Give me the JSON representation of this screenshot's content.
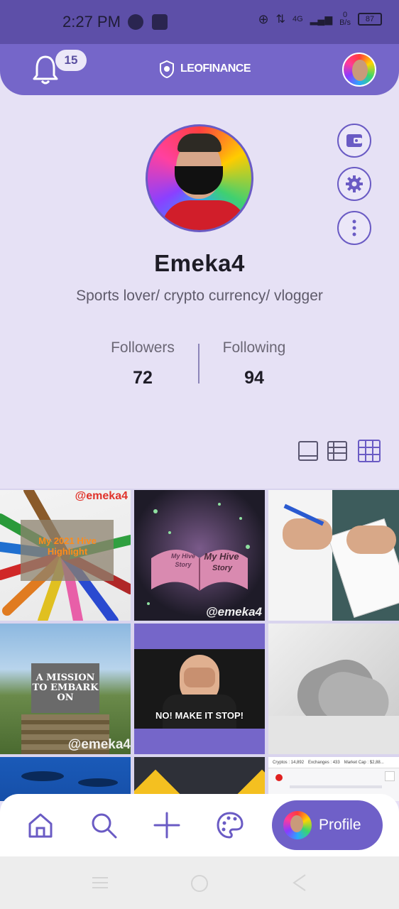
{
  "status_bar": {
    "time": "2:27 PM",
    "network": "4G",
    "data_rate_value": "0",
    "data_rate_unit": "B/s",
    "battery": "87"
  },
  "header": {
    "notification_count": "15",
    "brand": "LEOFINANCE",
    "icons": [
      "bell-icon",
      "leo-logo-icon",
      "avatar"
    ]
  },
  "profile": {
    "username": "Emeka4",
    "bio": "Sports lover/ crypto currency/ vlogger",
    "followers_label": "Followers",
    "followers_count": "72",
    "following_label": "Following",
    "following_count": "94"
  },
  "side_actions": [
    "wallet-icon",
    "settings-icon",
    "more-options-icon"
  ],
  "view_modes": [
    "single-view-icon",
    "list-view-icon",
    "grid-view-icon"
  ],
  "grid_posts": [
    {
      "watermark": "@emeka4",
      "title": "My 2021 Hive Highlight"
    },
    {
      "title_line1": "My Hive",
      "title_line2": "Story",
      "book_text_1": "My Hive",
      "book_text_2": "Story",
      "watermark": "@emeka4"
    },
    {
      "title": ""
    },
    {
      "title": "A MISSION TO EMBARK ON",
      "watermark": "@emeka4"
    },
    {
      "caption": "NO! MAKE IT STOP!"
    },
    {
      "title": ""
    },
    {
      "title": ""
    },
    {
      "title": ""
    },
    {
      "strip_1": "Cryptos : 14,892",
      "strip_2": "Exchanges : 433",
      "strip_3": "Market Cap : $2,88..."
    }
  ],
  "bottom_nav": {
    "items": [
      "home-icon",
      "search-icon",
      "add-icon",
      "palette-icon"
    ],
    "profile_label": "Profile"
  },
  "colors": {
    "accent": "#7566c9",
    "background": "#e6e1f5",
    "text_dark": "#1e1c26"
  }
}
